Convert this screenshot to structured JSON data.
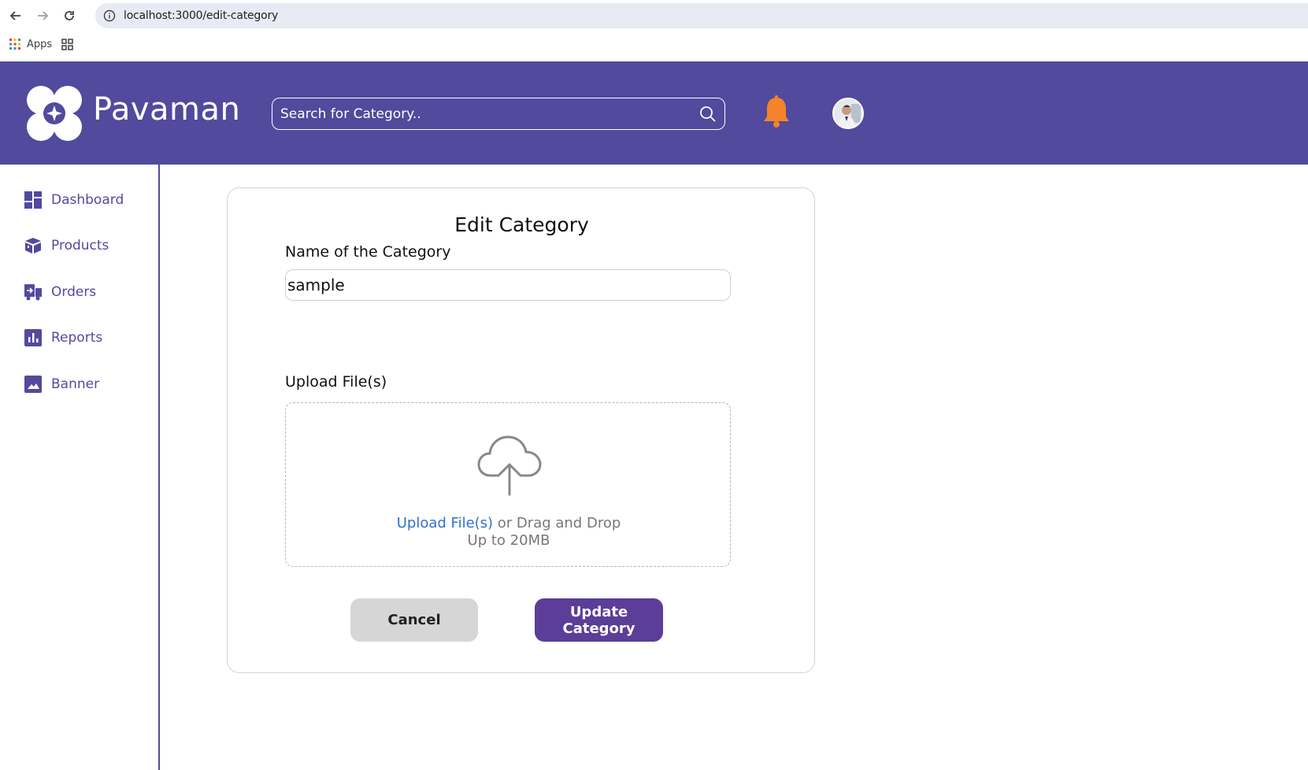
{
  "browser": {
    "url": "localhost:3000/edit-category",
    "bookmarks_apps_label": "Apps"
  },
  "header": {
    "brand": "Pavaman",
    "search_placeholder": "Search for Category..",
    "bell_color": "#f5832a",
    "background_color": "#514a9d"
  },
  "sidebar": {
    "items": [
      {
        "label": "Dashboard",
        "icon": "dashboard-icon"
      },
      {
        "label": "Products",
        "icon": "box-icon"
      },
      {
        "label": "Orders",
        "icon": "orders-icon"
      },
      {
        "label": "Reports",
        "icon": "bar-chart-icon"
      },
      {
        "label": "Banner",
        "icon": "image-icon"
      }
    ]
  },
  "form": {
    "title": "Edit Category",
    "name_label": "Name of the Category",
    "name_value": "sample",
    "upload_label": "Upload File(s)",
    "dropzone": {
      "link_text": "Upload File(s)",
      "rest_text": " or Drag and Drop",
      "limit_text": "Up to 20MB"
    },
    "cancel_label": "Cancel",
    "submit_label": "Update Category"
  }
}
